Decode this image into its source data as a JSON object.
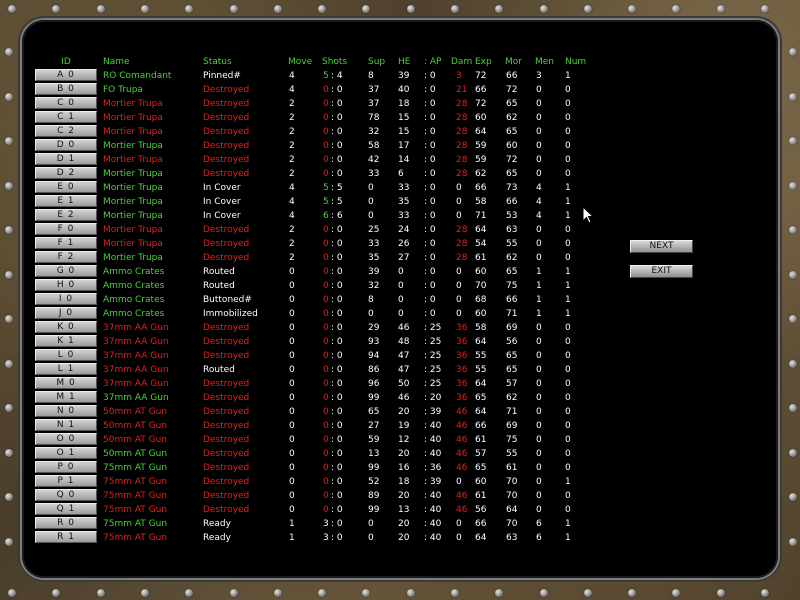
{
  "headers": {
    "id": "ID",
    "name": "Name",
    "status": "Status",
    "move": "Move",
    "shots": "Shots",
    "sup": "Sup",
    "he": "HE",
    "ap": ": AP",
    "dam": "Dam",
    "exp": "Exp",
    "mor": "Mor",
    "men": "Men",
    "num": "Num"
  },
  "buttons": {
    "next": "NEXT",
    "exit": "EXIT"
  },
  "colors": {
    "green": "#4ecf3c",
    "red": "#e0201c",
    "white": "#ffffff"
  },
  "rows": [
    {
      "id": "A 0",
      "name": "RO Comandant",
      "nc": "g",
      "status": "Pinned#",
      "sc": "w",
      "move": "4",
      "shots_a": "5",
      "sac": "g",
      "shots_b": ": 4",
      "sup": "8",
      "he": "39",
      "ap": ": 0",
      "dam": "3",
      "dc": "r",
      "exp": "72",
      "mor": "66",
      "men": "3",
      "num": "1"
    },
    {
      "id": "B 0",
      "name": "FO Trupa",
      "nc": "g",
      "status": "Destroyed",
      "sc": "r",
      "move": "4",
      "shots_a": "0",
      "sac": "r",
      "shots_b": ": 0",
      "sup": "37",
      "he": "40",
      "ap": ": 0",
      "dam": "21",
      "dc": "r",
      "exp": "66",
      "mor": "72",
      "men": "0",
      "num": "0"
    },
    {
      "id": "C 0",
      "name": "Mortier Trupa",
      "nc": "r",
      "status": "Destroyed",
      "sc": "r",
      "move": "2",
      "shots_a": "0",
      "sac": "r",
      "shots_b": ": 0",
      "sup": "37",
      "he": "18",
      "ap": ": 0",
      "dam": "28",
      "dc": "r",
      "exp": "72",
      "mor": "65",
      "men": "0",
      "num": "0"
    },
    {
      "id": "C 1",
      "name": "Mortier Trupa",
      "nc": "r",
      "status": "Destroyed",
      "sc": "r",
      "move": "2",
      "shots_a": "0",
      "sac": "r",
      "shots_b": ": 0",
      "sup": "78",
      "he": "15",
      "ap": ": 0",
      "dam": "28",
      "dc": "r",
      "exp": "60",
      "mor": "62",
      "men": "0",
      "num": "0"
    },
    {
      "id": "C 2",
      "name": "Mortier Trupa",
      "nc": "r",
      "status": "Destroyed",
      "sc": "r",
      "move": "2",
      "shots_a": "0",
      "sac": "r",
      "shots_b": ": 0",
      "sup": "32",
      "he": "15",
      "ap": ": 0",
      "dam": "28",
      "dc": "r",
      "exp": "64",
      "mor": "65",
      "men": "0",
      "num": "0"
    },
    {
      "id": "D 0",
      "name": "Mortier Trupa",
      "nc": "g",
      "status": "Destroyed",
      "sc": "r",
      "move": "2",
      "shots_a": "0",
      "sac": "r",
      "shots_b": ": 0",
      "sup": "58",
      "he": "17",
      "ap": ": 0",
      "dam": "28",
      "dc": "r",
      "exp": "59",
      "mor": "60",
      "men": "0",
      "num": "0"
    },
    {
      "id": "D 1",
      "name": "Mortier Trupa",
      "nc": "r",
      "status": "Destroyed",
      "sc": "r",
      "move": "2",
      "shots_a": "0",
      "sac": "r",
      "shots_b": ": 0",
      "sup": "42",
      "he": "14",
      "ap": ": 0",
      "dam": "28",
      "dc": "r",
      "exp": "59",
      "mor": "72",
      "men": "0",
      "num": "0"
    },
    {
      "id": "D 2",
      "name": "Mortier Trupa",
      "nc": "g",
      "status": "Destroyed",
      "sc": "r",
      "move": "2",
      "shots_a": "0",
      "sac": "r",
      "shots_b": ": 0",
      "sup": "33",
      "he": "6",
      "ap": ": 0",
      "dam": "28",
      "dc": "r",
      "exp": "62",
      "mor": "65",
      "men": "0",
      "num": "0"
    },
    {
      "id": "E 0",
      "name": "Mortier Trupa",
      "nc": "g",
      "status": "In Cover",
      "sc": "w",
      "move": "4",
      "shots_a": "5",
      "sac": "g",
      "shots_b": ": 5",
      "sup": "0",
      "he": "33",
      "ap": ": 0",
      "dam": "0",
      "dc": "w",
      "exp": "66",
      "mor": "73",
      "men": "4",
      "num": "1"
    },
    {
      "id": "E 1",
      "name": "Mortier Trupa",
      "nc": "g",
      "status": "In Cover",
      "sc": "w",
      "move": "4",
      "shots_a": "5",
      "sac": "g",
      "shots_b": ": 5",
      "sup": "0",
      "he": "35",
      "ap": ": 0",
      "dam": "0",
      "dc": "w",
      "exp": "58",
      "mor": "66",
      "men": "4",
      "num": "1"
    },
    {
      "id": "E 2",
      "name": "Mortier Trupa",
      "nc": "g",
      "status": "In Cover",
      "sc": "w",
      "move": "4",
      "shots_a": "6",
      "sac": "g",
      "shots_b": ": 6",
      "sup": "0",
      "he": "33",
      "ap": ": 0",
      "dam": "0",
      "dc": "w",
      "exp": "71",
      "mor": "53",
      "men": "4",
      "num": "1"
    },
    {
      "id": "F 0",
      "name": "Mortier Trupa",
      "nc": "r",
      "status": "Destroyed",
      "sc": "r",
      "move": "2",
      "shots_a": "0",
      "sac": "r",
      "shots_b": ": 0",
      "sup": "25",
      "he": "24",
      "ap": ": 0",
      "dam": "28",
      "dc": "r",
      "exp": "64",
      "mor": "63",
      "men": "0",
      "num": "0"
    },
    {
      "id": "F 1",
      "name": "Mortier Trupa",
      "nc": "r",
      "status": "Destroyed",
      "sc": "r",
      "move": "2",
      "shots_a": "0",
      "sac": "r",
      "shots_b": ": 0",
      "sup": "33",
      "he": "26",
      "ap": ": 0",
      "dam": "28",
      "dc": "r",
      "exp": "54",
      "mor": "55",
      "men": "0",
      "num": "0"
    },
    {
      "id": "F 2",
      "name": "Mortier Trupa",
      "nc": "g",
      "status": "Destroyed",
      "sc": "r",
      "move": "2",
      "shots_a": "0",
      "sac": "r",
      "shots_b": ": 0",
      "sup": "35",
      "he": "27",
      "ap": ": 0",
      "dam": "28",
      "dc": "r",
      "exp": "61",
      "mor": "62",
      "men": "0",
      "num": "0"
    },
    {
      "id": "G 0",
      "name": "Ammo Crates",
      "nc": "g",
      "status": "Routed",
      "sc": "w",
      "move": "0",
      "shots_a": "0",
      "sac": "r",
      "shots_b": ": 0",
      "sup": "39",
      "he": "0",
      "ap": ": 0",
      "dam": "0",
      "dc": "w",
      "exp": "60",
      "mor": "65",
      "men": "1",
      "num": "1"
    },
    {
      "id": "H 0",
      "name": "Ammo Crates",
      "nc": "g",
      "status": "Routed",
      "sc": "w",
      "move": "0",
      "shots_a": "0",
      "sac": "r",
      "shots_b": ": 0",
      "sup": "32",
      "he": "0",
      "ap": ": 0",
      "dam": "0",
      "dc": "w",
      "exp": "70",
      "mor": "75",
      "men": "1",
      "num": "1"
    },
    {
      "id": "I 0",
      "name": "Ammo Crates",
      "nc": "g",
      "status": "Buttoned#",
      "sc": "w",
      "move": "0",
      "shots_a": "0",
      "sac": "r",
      "shots_b": ": 0",
      "sup": "8",
      "he": "0",
      "ap": ": 0",
      "dam": "0",
      "dc": "w",
      "exp": "68",
      "mor": "66",
      "men": "1",
      "num": "1"
    },
    {
      "id": "J 0",
      "name": "Ammo Crates",
      "nc": "g",
      "status": "Immobilized",
      "sc": "w",
      "move": "0",
      "shots_a": "0",
      "sac": "r",
      "shots_b": ": 0",
      "sup": "0",
      "he": "0",
      "ap": ": 0",
      "dam": "0",
      "dc": "w",
      "exp": "60",
      "mor": "71",
      "men": "1",
      "num": "1"
    },
    {
      "id": "K 0",
      "name": "37mm AA Gun",
      "nc": "r",
      "status": "Destroyed",
      "sc": "r",
      "move": "0",
      "shots_a": "0",
      "sac": "r",
      "shots_b": ": 0",
      "sup": "29",
      "he": "46",
      "ap": ": 25",
      "dam": "36",
      "dc": "r",
      "exp": "58",
      "mor": "69",
      "men": "0",
      "num": "0"
    },
    {
      "id": "K 1",
      "name": "37mm AA Gun",
      "nc": "r",
      "status": "Destroyed",
      "sc": "r",
      "move": "0",
      "shots_a": "0",
      "sac": "r",
      "shots_b": ": 0",
      "sup": "93",
      "he": "48",
      "ap": ": 25",
      "dam": "36",
      "dc": "r",
      "exp": "64",
      "mor": "56",
      "men": "0",
      "num": "0"
    },
    {
      "id": "L 0",
      "name": "37mm AA Gun",
      "nc": "r",
      "status": "Destroyed",
      "sc": "r",
      "move": "0",
      "shots_a": "0",
      "sac": "r",
      "shots_b": ": 0",
      "sup": "94",
      "he": "47",
      "ap": ": 25",
      "dam": "36",
      "dc": "r",
      "exp": "55",
      "mor": "65",
      "men": "0",
      "num": "0"
    },
    {
      "id": "L 1",
      "name": "37mm AA Gun",
      "nc": "r",
      "status": "Routed",
      "sc": "w",
      "move": "0",
      "shots_a": "0",
      "sac": "r",
      "shots_b": ": 0",
      "sup": "86",
      "he": "47",
      "ap": ": 25",
      "dam": "36",
      "dc": "r",
      "exp": "55",
      "mor": "65",
      "men": "0",
      "num": "0"
    },
    {
      "id": "M 0",
      "name": "37mm AA Gun",
      "nc": "r",
      "status": "Destroyed",
      "sc": "r",
      "move": "0",
      "shots_a": "0",
      "sac": "r",
      "shots_b": ": 0",
      "sup": "96",
      "he": "50",
      "ap": ": 25",
      "dam": "36",
      "dc": "r",
      "exp": "64",
      "mor": "57",
      "men": "0",
      "num": "0"
    },
    {
      "id": "M 1",
      "name": "37mm AA Gun",
      "nc": "g",
      "status": "Destroyed",
      "sc": "r",
      "move": "0",
      "shots_a": "0",
      "sac": "r",
      "shots_b": ": 0",
      "sup": "99",
      "he": "46",
      "ap": ": 20",
      "dam": "36",
      "dc": "r",
      "exp": "65",
      "mor": "62",
      "men": "0",
      "num": "0"
    },
    {
      "id": "N 0",
      "name": "50mm AT Gun",
      "nc": "r",
      "status": "Destroyed",
      "sc": "r",
      "move": "0",
      "shots_a": "0",
      "sac": "r",
      "shots_b": ": 0",
      "sup": "65",
      "he": "20",
      "ap": ": 39",
      "dam": "46",
      "dc": "r",
      "exp": "64",
      "mor": "71",
      "men": "0",
      "num": "0"
    },
    {
      "id": "N 1",
      "name": "50mm AT Gun",
      "nc": "r",
      "status": "Destroyed",
      "sc": "r",
      "move": "0",
      "shots_a": "0",
      "sac": "r",
      "shots_b": ": 0",
      "sup": "27",
      "he": "19",
      "ap": ": 40",
      "dam": "46",
      "dc": "r",
      "exp": "66",
      "mor": "69",
      "men": "0",
      "num": "0"
    },
    {
      "id": "O 0",
      "name": "50mm AT Gun",
      "nc": "r",
      "status": "Destroyed",
      "sc": "r",
      "move": "0",
      "shots_a": "0",
      "sac": "r",
      "shots_b": ": 0",
      "sup": "59",
      "he": "12",
      "ap": ": 40",
      "dam": "46",
      "dc": "r",
      "exp": "61",
      "mor": "75",
      "men": "0",
      "num": "0"
    },
    {
      "id": "O 1",
      "name": "50mm AT Gun",
      "nc": "g",
      "status": "Destroyed",
      "sc": "r",
      "move": "0",
      "shots_a": "0",
      "sac": "r",
      "shots_b": ": 0",
      "sup": "13",
      "he": "20",
      "ap": ": 40",
      "dam": "46",
      "dc": "r",
      "exp": "57",
      "mor": "55",
      "men": "0",
      "num": "0"
    },
    {
      "id": "P 0",
      "name": "75mm AT Gun",
      "nc": "g",
      "status": "Destroyed",
      "sc": "r",
      "move": "0",
      "shots_a": "0",
      "sac": "r",
      "shots_b": ": 0",
      "sup": "99",
      "he": "16",
      "ap": ": 36",
      "dam": "46",
      "dc": "r",
      "exp": "65",
      "mor": "61",
      "men": "0",
      "num": "0"
    },
    {
      "id": "P 1",
      "name": "75mm AT Gun",
      "nc": "r",
      "status": "Destroyed",
      "sc": "r",
      "move": "0",
      "shots_a": "0",
      "sac": "r",
      "shots_b": ": 0",
      "sup": "52",
      "he": "18",
      "ap": ": 39",
      "dam": "0",
      "dc": "w",
      "exp": "60",
      "mor": "70",
      "men": "0",
      "num": "1"
    },
    {
      "id": "Q 0",
      "name": "75mm AT Gun",
      "nc": "r",
      "status": "Destroyed",
      "sc": "r",
      "move": "0",
      "shots_a": "0",
      "sac": "r",
      "shots_b": ": 0",
      "sup": "89",
      "he": "20",
      "ap": ": 40",
      "dam": "46",
      "dc": "r",
      "exp": "61",
      "mor": "70",
      "men": "0",
      "num": "0"
    },
    {
      "id": "Q 1",
      "name": "75mm AT Gun",
      "nc": "r",
      "status": "Destroyed",
      "sc": "r",
      "move": "0",
      "shots_a": "0",
      "sac": "r",
      "shots_b": ": 0",
      "sup": "99",
      "he": "13",
      "ap": ": 40",
      "dam": "46",
      "dc": "r",
      "exp": "56",
      "mor": "64",
      "men": "0",
      "num": "0"
    },
    {
      "id": "R 0",
      "name": "75mm AT Gun",
      "nc": "g",
      "status": "Ready",
      "sc": "w",
      "move": "1",
      "shots_a": "3",
      "sac": "w",
      "shots_b": ": 0",
      "sup": "0",
      "he": "20",
      "ap": ": 40",
      "dam": "0",
      "dc": "w",
      "exp": "66",
      "mor": "70",
      "men": "6",
      "num": "1"
    },
    {
      "id": "R 1",
      "name": "75mm AT Gun",
      "nc": "r",
      "status": "Ready",
      "sc": "w",
      "move": "1",
      "shots_a": "3",
      "sac": "w",
      "shots_b": ": 0",
      "sup": "0",
      "he": "20",
      "ap": ": 40",
      "dam": "0",
      "dc": "w",
      "exp": "64",
      "mor": "63",
      "men": "6",
      "num": "1"
    }
  ]
}
